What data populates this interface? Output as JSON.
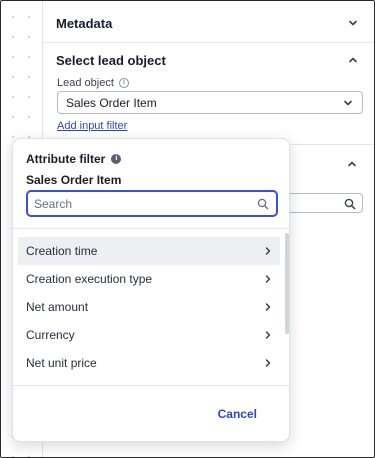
{
  "panel": {
    "metadata_section": {
      "title": "Metadata",
      "icon": "chevron-down-icon"
    },
    "lead_object_section": {
      "title": "Select lead object",
      "icon": "chevron-up-icon",
      "field_label": "Lead object",
      "field_info_icon": "info-outline-icon",
      "selected_value": "Sales Order Item",
      "add_filter_link": "Add input filter"
    },
    "collapsed_section": {
      "icon": "chevron-up-icon"
    }
  },
  "popover": {
    "title": "Attribute filter",
    "title_info_icon": "info-filled-icon",
    "subtitle": "Sales Order Item",
    "search": {
      "placeholder": "Search",
      "value": ""
    },
    "items": [
      {
        "label": "Creation time",
        "highlighted": true
      },
      {
        "label": "Creation execution type",
        "highlighted": false
      },
      {
        "label": "Net amount",
        "highlighted": false
      },
      {
        "label": "Currency",
        "highlighted": false
      },
      {
        "label": "Net unit price",
        "highlighted": false
      }
    ],
    "cancel_label": "Cancel"
  },
  "colors": {
    "accent": "#2f44c7",
    "focus_border": "#3d4fd0",
    "border": "#b7bac6",
    "highlight_row": "#eeeff2",
    "text": "#1b1d2c"
  }
}
